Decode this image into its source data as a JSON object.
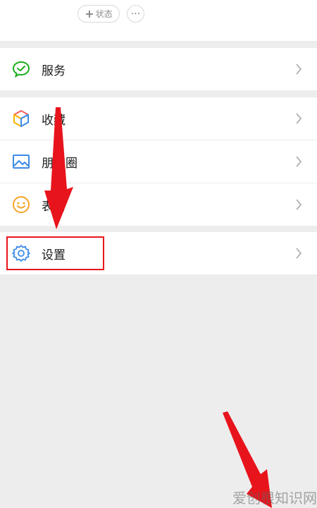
{
  "header": {
    "status_label": "状态",
    "more_label": "···"
  },
  "menu": {
    "services": "服务",
    "favorites": "收藏",
    "moments": "朋友圈",
    "stickers": "表情",
    "settings": "设置"
  },
  "watermark": "爱创根知识网",
  "colors": {
    "page_bg": "#ededed",
    "card_bg": "#ffffff",
    "annotation_red": "#e8141c",
    "settings_icon": "#3b8be6",
    "services_icon": "#1aad19"
  },
  "icons": {
    "services": "wechat-pay-icon",
    "favorites": "cube-icon",
    "moments": "image-icon",
    "stickers": "smiley-icon",
    "settings": "gear-icon",
    "chevron": "chevron-right-icon"
  }
}
